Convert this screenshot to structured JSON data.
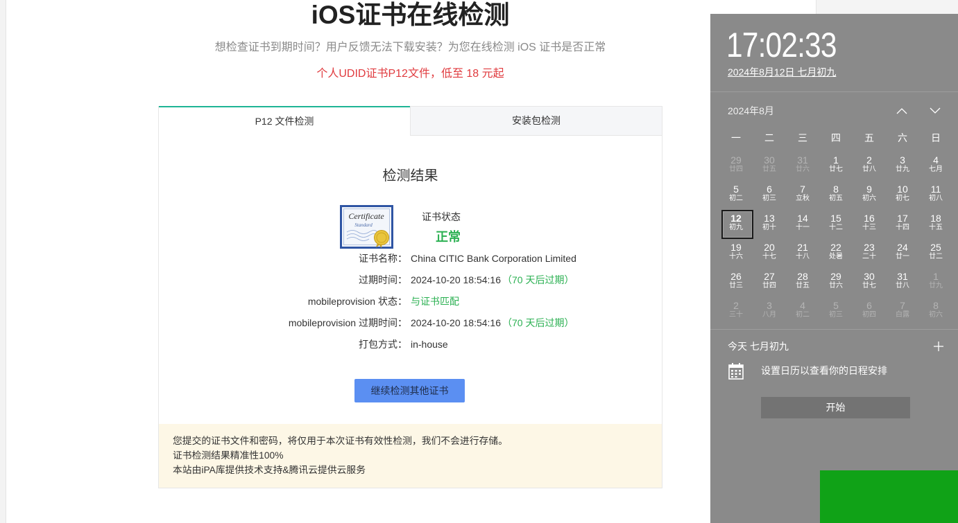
{
  "page": {
    "title": "iOS证书在线检测",
    "subtitle": "想检查证书到期时间？用户反馈无法下载安装？为您在线检测 iOS 证书是否正常",
    "promo": "个人UDID证书P12文件，低至 18 元起"
  },
  "tabs": [
    {
      "label": "P12 文件检测",
      "active": true
    },
    {
      "label": "安装包检测",
      "active": false
    }
  ],
  "result": {
    "heading": "检测结果",
    "cert_image": {
      "title": "Certificate",
      "subtitle": "Standard"
    },
    "status_label": "证书状态",
    "status_value": "正常",
    "rows": [
      {
        "label": "证书名称：",
        "value": "China CITIC Bank Corporation Limited"
      },
      {
        "label": "过期时间：",
        "value": "2024-10-20 18:54:16",
        "note": "（70 天后过期）"
      },
      {
        "label": "mobileprovision 状态：",
        "value": "与证书匹配"
      },
      {
        "label": "mobileprovision 过期时间：",
        "value": "2024-10-20 18:54:16",
        "note": "（70 天后过期）"
      },
      {
        "label": "打包方式：",
        "value": "in-house"
      }
    ],
    "continue_button": "继续检测其他证书"
  },
  "notice": {
    "lines": [
      "您提交的证书文件和密码，将仅用于本次证书有效性检测，我们不会进行存储。",
      "证书检测结果精准性100%",
      "本站由iPA库提供技术支持&腾讯云提供云服务"
    ]
  },
  "calendar": {
    "time": "17:02:33",
    "date": "2024年8月12日 七月初九",
    "month": "2024年8月",
    "weekdays": [
      "一",
      "二",
      "三",
      "四",
      "五",
      "六",
      "日"
    ],
    "weeks": [
      [
        {
          "day": "29",
          "lunar": "廿四",
          "other": true
        },
        {
          "day": "30",
          "lunar": "廿五",
          "other": true
        },
        {
          "day": "31",
          "lunar": "廿六",
          "other": true
        },
        {
          "day": "1",
          "lunar": "廿七"
        },
        {
          "day": "2",
          "lunar": "廿八"
        },
        {
          "day": "3",
          "lunar": "廿九"
        },
        {
          "day": "4",
          "lunar": "七月"
        }
      ],
      [
        {
          "day": "5",
          "lunar": "初二"
        },
        {
          "day": "6",
          "lunar": "初三"
        },
        {
          "day": "7",
          "lunar": "立秋"
        },
        {
          "day": "8",
          "lunar": "初五"
        },
        {
          "day": "9",
          "lunar": "初六"
        },
        {
          "day": "10",
          "lunar": "初七"
        },
        {
          "day": "11",
          "lunar": "初八"
        }
      ],
      [
        {
          "day": "12",
          "lunar": "初九",
          "selected": true
        },
        {
          "day": "13",
          "lunar": "初十"
        },
        {
          "day": "14",
          "lunar": "十一"
        },
        {
          "day": "15",
          "lunar": "十二"
        },
        {
          "day": "16",
          "lunar": "十三"
        },
        {
          "day": "17",
          "lunar": "十四"
        },
        {
          "day": "18",
          "lunar": "十五"
        }
      ],
      [
        {
          "day": "19",
          "lunar": "十六"
        },
        {
          "day": "20",
          "lunar": "十七"
        },
        {
          "day": "21",
          "lunar": "十八"
        },
        {
          "day": "22",
          "lunar": "处暑"
        },
        {
          "day": "23",
          "lunar": "二十"
        },
        {
          "day": "24",
          "lunar": "廿一"
        },
        {
          "day": "25",
          "lunar": "廿二"
        }
      ],
      [
        {
          "day": "26",
          "lunar": "廿三"
        },
        {
          "day": "27",
          "lunar": "廿四"
        },
        {
          "day": "28",
          "lunar": "廿五"
        },
        {
          "day": "29",
          "lunar": "廿六"
        },
        {
          "day": "30",
          "lunar": "廿七"
        },
        {
          "day": "31",
          "lunar": "廿八"
        },
        {
          "day": "1",
          "lunar": "廿九",
          "other": true
        }
      ],
      [
        {
          "day": "2",
          "lunar": "三十",
          "other": true
        },
        {
          "day": "3",
          "lunar": "八月",
          "other": true
        },
        {
          "day": "4",
          "lunar": "初二",
          "other": true
        },
        {
          "day": "5",
          "lunar": "初三",
          "other": true
        },
        {
          "day": "6",
          "lunar": "初四",
          "other": true
        },
        {
          "day": "7",
          "lunar": "白露",
          "other": true
        },
        {
          "day": "8",
          "lunar": "初六",
          "other": true
        }
      ]
    ],
    "agenda_title": "今天 七月初九",
    "agenda_message": "设置日历以查看你的日程安排",
    "start_button": "开始"
  },
  "icons": {
    "certificate": "certificate-image",
    "prev_month": "chevron-up-icon",
    "next_month": "chevron-down-icon",
    "add_event": "plus-icon",
    "agenda": "calendar-icon"
  },
  "colors": {
    "accent": "#1db495",
    "promo_red": "#e03a3e",
    "green": "#2bb052",
    "btn_blue": "#5b8ff2",
    "notice_bg": "#fdf7e6",
    "flyout_bg": "#8a8a8a",
    "flyout_btn": "#737373",
    "green_block": "#10a217"
  }
}
